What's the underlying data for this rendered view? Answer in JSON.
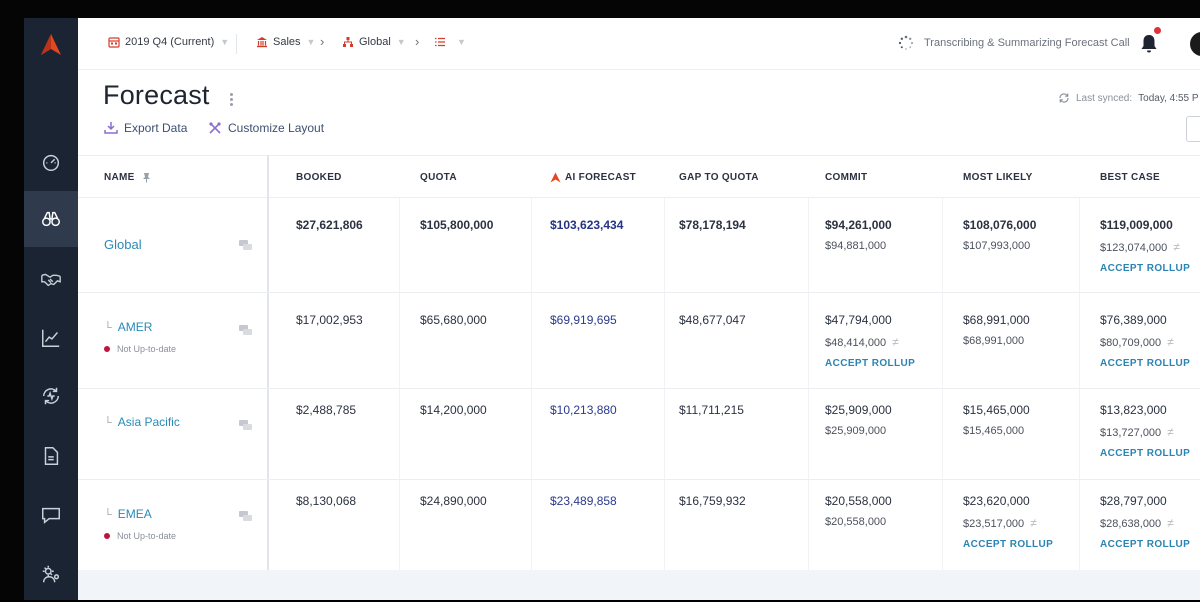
{
  "colors": {
    "sidebar": "#1b2433",
    "accent": "#e1481f",
    "link": "#2a8ab8",
    "ai_value": "#2a3a8c",
    "accept": "#2b84b4",
    "status_dot": "#c0143c"
  },
  "header": {
    "period": "2019 Q4 (Current)",
    "team": "Sales",
    "region": "Global",
    "status_text": "Transcribing & Summarizing Forecast Call"
  },
  "sidebar": {
    "items": [
      {
        "icon": "dashboard-icon"
      },
      {
        "icon": "binoculars-icon",
        "active": true
      },
      {
        "icon": "handshake-icon"
      },
      {
        "icon": "chart-line-icon"
      },
      {
        "icon": "sync-activity-icon"
      },
      {
        "icon": "document-icon"
      },
      {
        "icon": "chat-icon"
      },
      {
        "icon": "settings-icon"
      }
    ]
  },
  "page": {
    "title": "Forecast",
    "export_label": "Export Data",
    "customize_label": "Customize Layout",
    "synced_label": "Last synced:",
    "synced_value": "Today, 4:55 P"
  },
  "table": {
    "columns": [
      "NAME",
      "BOOKED",
      "QUOTA",
      "AI FORECAST",
      "GAP TO QUOTA",
      "COMMIT",
      "MOST LIKELY",
      "BEST CASE"
    ],
    "accept_label": "ACCEPT ROLLUP",
    "not_up_to_date": "Not Up-to-date",
    "rows": [
      {
        "name": "Global",
        "booked": "$27,621,806",
        "quota": "$105,800,000",
        "ai_forecast": "$103,623,434",
        "gap": "$78,178,194",
        "commit": "$94,261,000",
        "commit_sub": "$94,881,000",
        "most_likely": "$108,076,000",
        "most_likely_sub": "$107,993,000",
        "best_case": "$119,009,000",
        "best_case_sub": "$123,074,000"
      },
      {
        "name": "AMER",
        "booked": "$17,002,953",
        "quota": "$65,680,000",
        "ai_forecast": "$69,919,695",
        "gap": "$48,677,047",
        "commit": "$47,794,000",
        "commit_sub": "$48,414,000",
        "most_likely": "$68,991,000",
        "most_likely_sub": "$68,991,000",
        "best_case": "$76,389,000",
        "best_case_sub": "$80,709,000"
      },
      {
        "name": "Asia Pacific",
        "booked": "$2,488,785",
        "quota": "$14,200,000",
        "ai_forecast": "$10,213,880",
        "gap": "$11,711,215",
        "commit": "$25,909,000",
        "commit_sub": "$25,909,000",
        "most_likely": "$15,465,000",
        "most_likely_sub": "$15,465,000",
        "best_case": "$13,823,000",
        "best_case_sub": "$13,727,000"
      },
      {
        "name": "EMEA",
        "booked": "$8,130,068",
        "quota": "$24,890,000",
        "ai_forecast": "$23,489,858",
        "gap": "$16,759,932",
        "commit": "$20,558,000",
        "commit_sub": "$20,558,000",
        "most_likely": "$23,620,000",
        "most_likely_sub": "$23,517,000",
        "best_case": "$28,797,000",
        "best_case_sub": "$28,638,000"
      }
    ]
  }
}
